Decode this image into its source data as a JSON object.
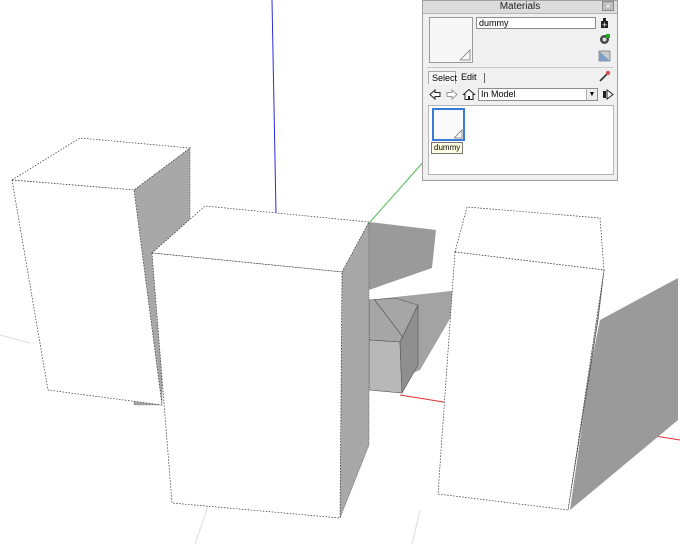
{
  "materials": {
    "title": "Materials",
    "close_label": "×",
    "name_value": "dummy",
    "tabs": [
      "Select",
      "Edit"
    ],
    "collection": "In Model",
    "thumbnail_tooltip": "dummy",
    "icons": [
      "create-material-icon",
      "default-material-icon",
      "display-secondary-icon",
      "eyedropper-icon",
      "back-arrow-icon",
      "forward-arrow-icon",
      "home-icon",
      "details-arrow-icon"
    ]
  },
  "scene": {
    "axis_colors": {
      "blue": "#2a2adf",
      "red": "#e03030",
      "green": "#4fbf4f"
    },
    "shadow_color": "#9a9a9a",
    "face_color": "#ffffff",
    "side_color": "#a8a8a8"
  }
}
